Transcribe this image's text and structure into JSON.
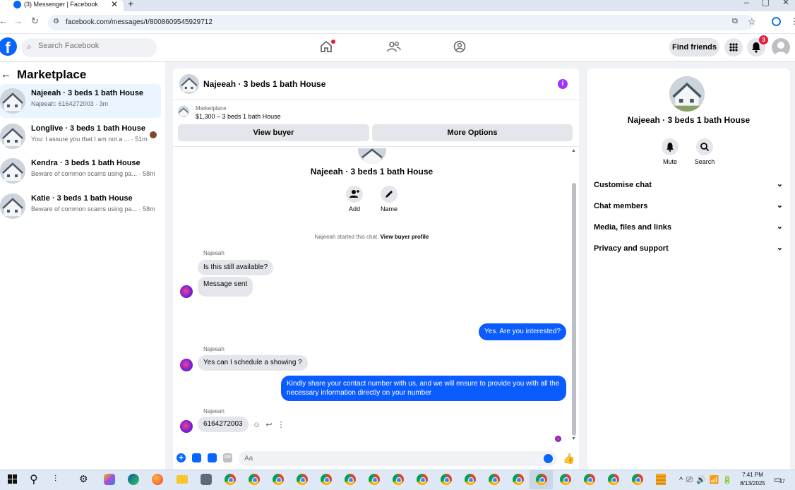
{
  "browser": {
    "tab_title": "(3) Messenger | Facebook",
    "tab_close": "✕",
    "new_tab": "+",
    "url": "facebook.com/messages/t/8008609545929712",
    "icons": [
      "back-icon",
      "forward-icon",
      "reload-icon",
      "site-info-icon",
      "install-icon",
      "star-icon",
      "profile-icon",
      "menu-icon"
    ]
  },
  "header": {
    "logo": "f",
    "search_placeholder": "Search Facebook",
    "find_friends_label": "Find friends",
    "notification_count": "3",
    "brand_color": "#0866ff",
    "badge_color": "#e41e3f"
  },
  "sidebar": {
    "title": "Marketplace",
    "conversations": [
      {
        "name": "Najeeah · 3 beds 1 bath House",
        "preview": "Najeeah: 6164272003 · 3m",
        "active": true
      },
      {
        "name": "Longlive · 3 beds 1 bath House",
        "preview": "You: I assure you that I am not a ... · 51m",
        "active": false
      },
      {
        "name": "Kendra · 3 beds 1 bath House",
        "preview": "Beware of common scams using pa... · 58m",
        "active": false
      },
      {
        "name": "Katie · 3 beds 1 bath House",
        "preview": "Beware of common scams using pa... · 58m",
        "active": false
      }
    ]
  },
  "chat": {
    "title": "Najeeah · 3 beds 1 bath House",
    "info_icon": "i",
    "marketplace_label": "Marketplace",
    "listing": "$1,300 – 3 beds 1 bath House",
    "view_buyer_label": "View buyer",
    "more_options_label": "More Options",
    "profile_name": "Najeeah · 3 beds 1 bath House",
    "add_label": "Add",
    "name_label": "Name",
    "started_text": "Najeeah started this chat.",
    "started_link": "View buyer profile",
    "messages": [
      {
        "sender": "Najeeah",
        "direction": "in",
        "text": "Is this still available?"
      },
      {
        "direction": "in",
        "text": "Message sent"
      },
      {
        "direction": "out",
        "text": "Yes. Are you interested?"
      },
      {
        "sender": "Najeeah",
        "direction": "in",
        "text": "Yes can I schedule a showing ?"
      },
      {
        "direction": "out",
        "text": "Kindly share your contact number with us, and we will ensure to provide you with all the necessary information directly on your number"
      },
      {
        "sender": "Najeeah",
        "direction": "in",
        "text": "6164272003"
      }
    ],
    "composer_placeholder": "Aa",
    "outgoing_color": "#0a5cff"
  },
  "info_panel": {
    "name": "Najeeah · 3 beds 1 bath House",
    "mute_label": "Mute",
    "search_label": "Search",
    "sections": [
      "Customise chat",
      "Chat members",
      "Media, files and links",
      "Privacy and support"
    ]
  },
  "taskbar": {
    "time": "7:41 PM",
    "date": "8/13/2025",
    "notification_count": "17"
  }
}
